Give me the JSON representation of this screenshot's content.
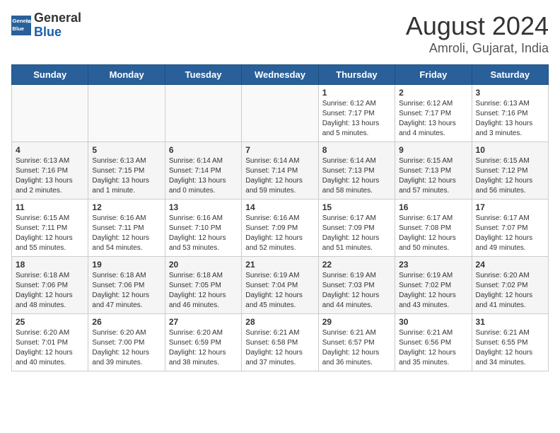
{
  "logo": {
    "line1": "General",
    "line2": "Blue"
  },
  "title": "August 2024",
  "subtitle": "Amroli, Gujarat, India",
  "weekdays": [
    "Sunday",
    "Monday",
    "Tuesday",
    "Wednesday",
    "Thursday",
    "Friday",
    "Saturday"
  ],
  "weeks": [
    [
      {
        "day": "",
        "info": ""
      },
      {
        "day": "",
        "info": ""
      },
      {
        "day": "",
        "info": ""
      },
      {
        "day": "",
        "info": ""
      },
      {
        "day": "1",
        "info": "Sunrise: 6:12 AM\nSunset: 7:17 PM\nDaylight: 13 hours\nand 5 minutes."
      },
      {
        "day": "2",
        "info": "Sunrise: 6:12 AM\nSunset: 7:17 PM\nDaylight: 13 hours\nand 4 minutes."
      },
      {
        "day": "3",
        "info": "Sunrise: 6:13 AM\nSunset: 7:16 PM\nDaylight: 13 hours\nand 3 minutes."
      }
    ],
    [
      {
        "day": "4",
        "info": "Sunrise: 6:13 AM\nSunset: 7:16 PM\nDaylight: 13 hours\nand 2 minutes."
      },
      {
        "day": "5",
        "info": "Sunrise: 6:13 AM\nSunset: 7:15 PM\nDaylight: 13 hours\nand 1 minute."
      },
      {
        "day": "6",
        "info": "Sunrise: 6:14 AM\nSunset: 7:14 PM\nDaylight: 13 hours\nand 0 minutes."
      },
      {
        "day": "7",
        "info": "Sunrise: 6:14 AM\nSunset: 7:14 PM\nDaylight: 12 hours\nand 59 minutes."
      },
      {
        "day": "8",
        "info": "Sunrise: 6:14 AM\nSunset: 7:13 PM\nDaylight: 12 hours\nand 58 minutes."
      },
      {
        "day": "9",
        "info": "Sunrise: 6:15 AM\nSunset: 7:13 PM\nDaylight: 12 hours\nand 57 minutes."
      },
      {
        "day": "10",
        "info": "Sunrise: 6:15 AM\nSunset: 7:12 PM\nDaylight: 12 hours\nand 56 minutes."
      }
    ],
    [
      {
        "day": "11",
        "info": "Sunrise: 6:15 AM\nSunset: 7:11 PM\nDaylight: 12 hours\nand 55 minutes."
      },
      {
        "day": "12",
        "info": "Sunrise: 6:16 AM\nSunset: 7:11 PM\nDaylight: 12 hours\nand 54 minutes."
      },
      {
        "day": "13",
        "info": "Sunrise: 6:16 AM\nSunset: 7:10 PM\nDaylight: 12 hours\nand 53 minutes."
      },
      {
        "day": "14",
        "info": "Sunrise: 6:16 AM\nSunset: 7:09 PM\nDaylight: 12 hours\nand 52 minutes."
      },
      {
        "day": "15",
        "info": "Sunrise: 6:17 AM\nSunset: 7:09 PM\nDaylight: 12 hours\nand 51 minutes."
      },
      {
        "day": "16",
        "info": "Sunrise: 6:17 AM\nSunset: 7:08 PM\nDaylight: 12 hours\nand 50 minutes."
      },
      {
        "day": "17",
        "info": "Sunrise: 6:17 AM\nSunset: 7:07 PM\nDaylight: 12 hours\nand 49 minutes."
      }
    ],
    [
      {
        "day": "18",
        "info": "Sunrise: 6:18 AM\nSunset: 7:06 PM\nDaylight: 12 hours\nand 48 minutes."
      },
      {
        "day": "19",
        "info": "Sunrise: 6:18 AM\nSunset: 7:06 PM\nDaylight: 12 hours\nand 47 minutes."
      },
      {
        "day": "20",
        "info": "Sunrise: 6:18 AM\nSunset: 7:05 PM\nDaylight: 12 hours\nand 46 minutes."
      },
      {
        "day": "21",
        "info": "Sunrise: 6:19 AM\nSunset: 7:04 PM\nDaylight: 12 hours\nand 45 minutes."
      },
      {
        "day": "22",
        "info": "Sunrise: 6:19 AM\nSunset: 7:03 PM\nDaylight: 12 hours\nand 44 minutes."
      },
      {
        "day": "23",
        "info": "Sunrise: 6:19 AM\nSunset: 7:02 PM\nDaylight: 12 hours\nand 43 minutes."
      },
      {
        "day": "24",
        "info": "Sunrise: 6:20 AM\nSunset: 7:02 PM\nDaylight: 12 hours\nand 41 minutes."
      }
    ],
    [
      {
        "day": "25",
        "info": "Sunrise: 6:20 AM\nSunset: 7:01 PM\nDaylight: 12 hours\nand 40 minutes."
      },
      {
        "day": "26",
        "info": "Sunrise: 6:20 AM\nSunset: 7:00 PM\nDaylight: 12 hours\nand 39 minutes."
      },
      {
        "day": "27",
        "info": "Sunrise: 6:20 AM\nSunset: 6:59 PM\nDaylight: 12 hours\nand 38 minutes."
      },
      {
        "day": "28",
        "info": "Sunrise: 6:21 AM\nSunset: 6:58 PM\nDaylight: 12 hours\nand 37 minutes."
      },
      {
        "day": "29",
        "info": "Sunrise: 6:21 AM\nSunset: 6:57 PM\nDaylight: 12 hours\nand 36 minutes."
      },
      {
        "day": "30",
        "info": "Sunrise: 6:21 AM\nSunset: 6:56 PM\nDaylight: 12 hours\nand 35 minutes."
      },
      {
        "day": "31",
        "info": "Sunrise: 6:21 AM\nSunset: 6:55 PM\nDaylight: 12 hours\nand 34 minutes."
      }
    ]
  ]
}
